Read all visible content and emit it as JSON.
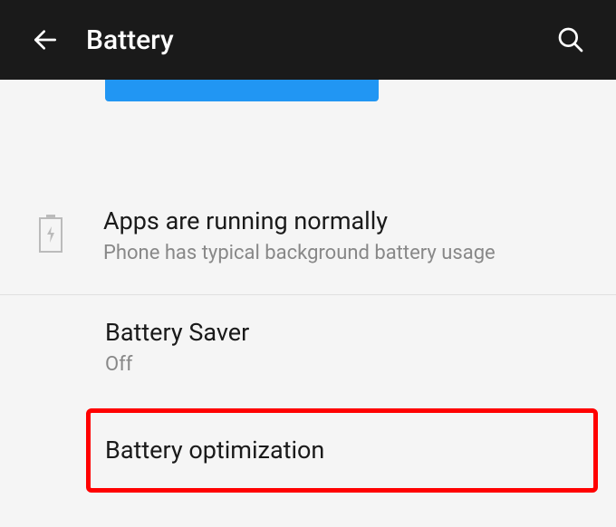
{
  "header": {
    "title": "Battery"
  },
  "status": {
    "title": "Apps are running normally",
    "subtitle": "Phone has typical background battery usage"
  },
  "items": [
    {
      "title": "Battery Saver",
      "subtitle": "Off"
    },
    {
      "title": "Battery optimization"
    }
  ]
}
